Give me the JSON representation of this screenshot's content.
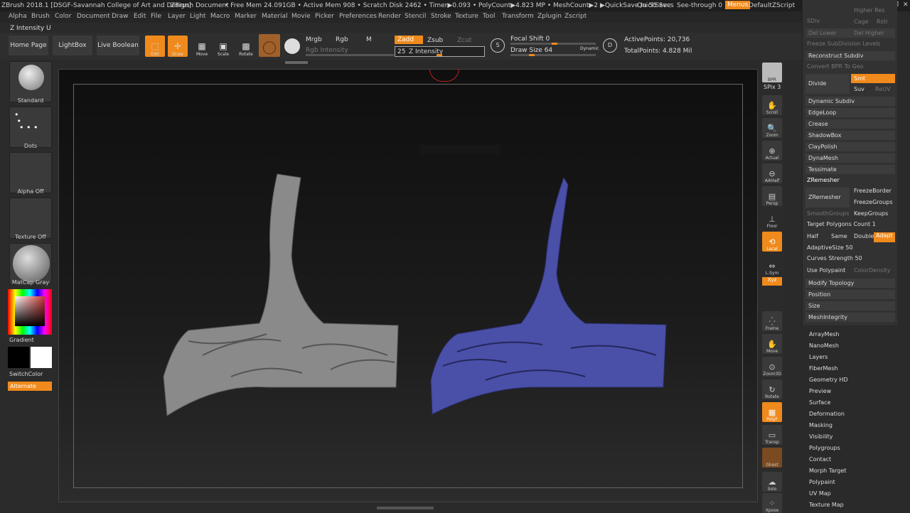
{
  "titlebar": {
    "app": "ZBrush 2018.1 [DSGF-Savannah College of Art and Design]",
    "doc": "ZBrush Document",
    "stats": "• Free Mem 24.091GB • Active Mem 908 • Scratch Disk 2462 • Timer▶0.093 • PolyCount▶4.823 MP • MeshCount▶2 ▶QuickSave In 55 Secs",
    "quicksave": "QuickSave",
    "seethrough": "See-through 0",
    "menus": "Menus",
    "script": "DefaultZScript"
  },
  "menu": [
    "Alpha",
    "Brush",
    "Color",
    "Document",
    "Draw",
    "Edit",
    "File",
    "Layer",
    "Light",
    "Macro",
    "Marker",
    "Material",
    "Movie",
    "Picker",
    "Preferences",
    "Render",
    "Stencil",
    "Stroke",
    "Texture",
    "Tool",
    "Transform",
    "Zplugin",
    "Zscript"
  ],
  "zintensity_label": "Z Intensity U",
  "toolbar": {
    "home": "Home Page",
    "lightbox": "LightBox",
    "liveboolean": "Live Boolean",
    "edit": "Edit",
    "draw": "Draw",
    "move": "Move",
    "scale": "Scale",
    "rotate": "Rotate",
    "mrgb": "Mrgb",
    "rgb": "Rgb",
    "m": "M",
    "rgb_intensity": "Rgb Intensity",
    "zadd": "Zadd",
    "zsub": "Zsub",
    "zcut": "Zcut",
    "z_intensity_value": "25",
    "z_intensity_label": "Z Intensity",
    "focal_shift": "Focal Shift 0",
    "draw_size": "Draw Size 64",
    "dynamic": "Dynamic",
    "active_points": "ActivePoints: 20,736",
    "total_points": "TotalPoints: 4.828 Mil"
  },
  "left": {
    "standard": "Standard",
    "dots": "Dots",
    "alpha": "Alpha Off",
    "texture": "Texture Off",
    "matcap": "MatCap Gray",
    "gradient": "Gradient",
    "switchcolor": "SwitchColor",
    "alternate": "Alternate"
  },
  "shelf": [
    "BPR",
    "SPix 3",
    "Scroll",
    "Zoom",
    "Actual",
    "AAHalf",
    "Persp",
    "Floor",
    "Local",
    "L.Sym",
    "Xyz",
    "Frame",
    "Move",
    "Zoom3D",
    "Rotate",
    "PolyF",
    "Transp",
    "Ghost",
    "Solo",
    "Xpose"
  ],
  "panel": {
    "sdiv": "SDiv",
    "higher_res": "Higher Res",
    "cage": "Cage",
    "rstr": "Rstr",
    "del_lower": "Del Lower",
    "del_higher": "Del Higher",
    "freeze_subdiv": "Freeze SubDivision Levels",
    "reconstruct": "Reconstruct Subdiv",
    "convert_bpr": "Convert BPR To Geo",
    "divide": "Divide",
    "smt": "Smt",
    "suv": "Suv",
    "reuv": "ReUV",
    "dynamic_subdiv": "Dynamic Subdiv",
    "edgeloop": "EdgeLoop",
    "crease": "Crease",
    "shadowbox": "ShadowBox",
    "claypolish": "ClayPolish",
    "dynamesh": "DynaMesh",
    "tessimate": "Tessimate",
    "zremesher_hdr": "ZRemesher",
    "zremesher_btn": "ZRemesher",
    "freezeborder": "FreezeBorder",
    "freezegroups": "FreezeGroups",
    "smoothgroups": "SmoothGroups",
    "keepgroups": "KeepGroups",
    "target_poly": "Target Polygons Count 1",
    "half": "Half",
    "same": "Same",
    "double": "Double",
    "adapt": "Adapt",
    "adaptive_size": "AdaptiveSize 50",
    "curves_strength": "Curves Strength 50",
    "use_polypaint": "Use Polypaint",
    "color_density": "ColorDensity",
    "modify_topology": "Modify Topology",
    "position": "Position",
    "size": "Size",
    "meshintegrity": "MeshIntegrity"
  },
  "list": [
    "ArrayMesh",
    "NanoMesh",
    "Layers",
    "FiberMesh",
    "Geometry HD",
    "Preview",
    "Surface",
    "Deformation",
    "Masking",
    "Visibility",
    "Polygroups",
    "Contact",
    "Morph Target",
    "Polypaint",
    "UV Map",
    "Texture Map"
  ],
  "colors": {
    "accent": "#f08a1c",
    "mesh_gray": "#8a8a8a",
    "mesh_blue": "#4a4fa8"
  }
}
